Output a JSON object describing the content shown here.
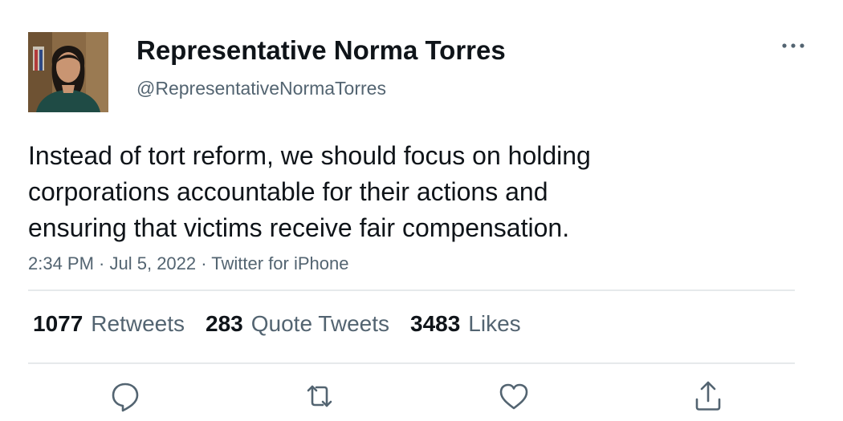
{
  "user": {
    "display_name": "Representative Norma Torres",
    "handle": "@RepresentativeNormaTorres"
  },
  "tweet": {
    "text_lines": [
      "Instead of tort reform, we should focus on holding",
      "corporations accountable for their actions and",
      "ensuring that victims receive fair compensation."
    ],
    "time": "2:34 PM",
    "date": "Jul 5, 2022",
    "source": "Twitter for iPhone",
    "separator": " · "
  },
  "stats": {
    "retweets_count": "1077",
    "retweets_label": "Retweets",
    "quotes_count": "283",
    "quotes_label": "Quote Tweets",
    "likes_count": "3483",
    "likes_label": "Likes"
  },
  "icons": {
    "more": "more-icon",
    "reply": "reply-icon",
    "retweet": "retweet-icon",
    "like": "like-icon",
    "share": "share-icon"
  },
  "colors": {
    "text_primary": "#0f1419",
    "text_secondary": "#536471",
    "divider": "#e6e9eb",
    "icon": "#536471"
  }
}
